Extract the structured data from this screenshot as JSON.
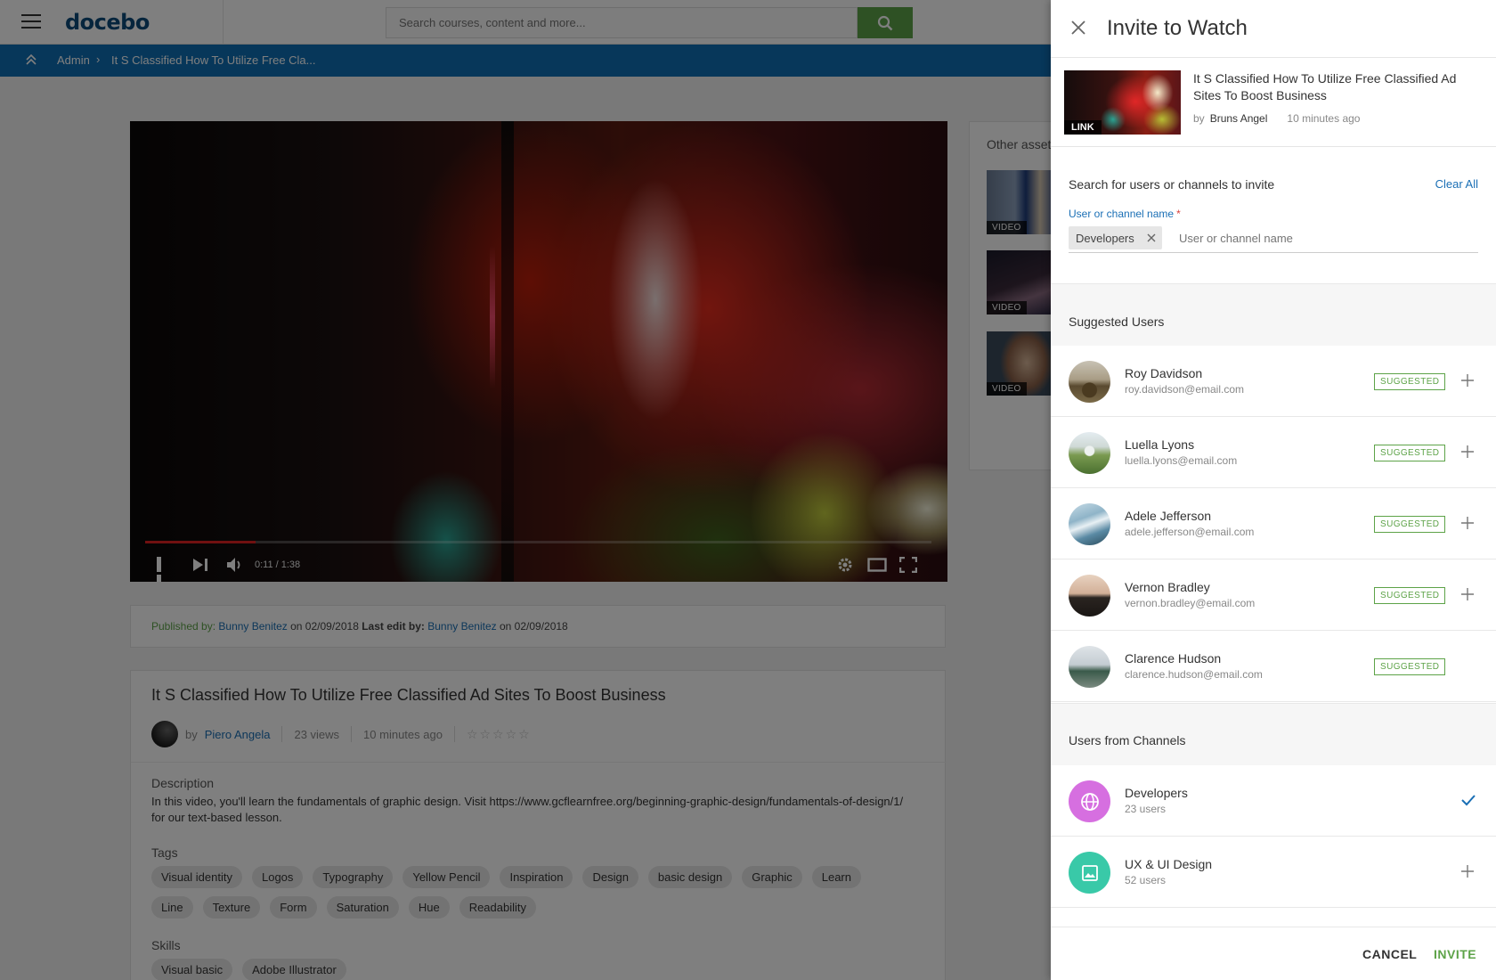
{
  "header": {
    "logo": "docebo",
    "search_placeholder": "Search courses, content and more..."
  },
  "breadcrumb": {
    "admin": "Admin",
    "separator": "›",
    "current": "It S Classified How To Utilize Free Cla..."
  },
  "video": {
    "time": "0:11 / 1:38",
    "progress": 0.14
  },
  "publish": {
    "published_label": "Published by:",
    "published_by": "Bunny Benitez",
    "published_on": "on 02/09/2018",
    "last_edit_label": "Last edit by:",
    "last_edit_by": "Bunny Benitez",
    "last_edit_on": "on 02/09/2018"
  },
  "details": {
    "title": "It S Classified How To Utilize Free Classified Ad Sites To Boost Business",
    "by": "by",
    "author": "Piero Angela",
    "views": "23 views",
    "time_ago": "10 minutes ago",
    "stars": "☆☆☆☆☆",
    "description_heading": "Description",
    "description": "In this video, you'll learn the fundamentals of graphic design. Visit https://www.gcflearnfree.org/beginning-graphic-design/fundamentals-of-design/1/ for our text-based lesson.",
    "tags_heading": "Tags",
    "tags_row1": [
      "Visual identity",
      "Logos",
      "Typography",
      "Yellow Pencil",
      "Inspiration",
      "Design",
      "basic design",
      "Graphic",
      "Learn"
    ],
    "tags_row2": [
      "Line",
      "Texture",
      "Form",
      "Saturation",
      "Hue",
      "Readability"
    ],
    "skills_heading": "Skills",
    "skills": [
      "Visual basic",
      "Adobe Illustrator"
    ]
  },
  "other_assets": {
    "title": "Other assets",
    "badges": [
      "VIDEO",
      "VIDEO",
      "VIDEO"
    ]
  },
  "panel": {
    "title": "Invite to Watch",
    "asset": {
      "badge": "LINK",
      "title": "It S Classified How To Utilize Free Classified Ad Sites To Boost Business",
      "by": "by",
      "author": "Bruns Angel",
      "time_ago": "10 minutes ago"
    },
    "search_heading": "Search for users or channels to invite",
    "clear_all": "Clear All",
    "field_label": "User or channel name",
    "required_mark": "*",
    "chip": "Developers",
    "input_placeholder": "User or channel name",
    "suggested_heading": "Suggested Users",
    "suggested_badge": "SUGGESTED",
    "users": [
      {
        "name": "Roy Davidson",
        "email": "roy.davidson@email.com"
      },
      {
        "name": "Luella Lyons",
        "email": "luella.lyons@email.com"
      },
      {
        "name": "Adele Jefferson",
        "email": "adele.jefferson@email.com"
      },
      {
        "name": "Vernon Bradley",
        "email": "vernon.bradley@email.com"
      },
      {
        "name": "Clarence Hudson",
        "email": "clarence.hudson@email.com"
      }
    ],
    "channels_heading": "Users from Channels",
    "channels": [
      {
        "name": "Developers",
        "count": "23 users",
        "color": "#d66fe0",
        "icon": "globe-icon"
      },
      {
        "name": "UX & UI Design",
        "count": "52 users",
        "color": "#39c9a8",
        "icon": "image-icon"
      }
    ],
    "cancel": "CANCEL",
    "invite": "INVITE"
  }
}
